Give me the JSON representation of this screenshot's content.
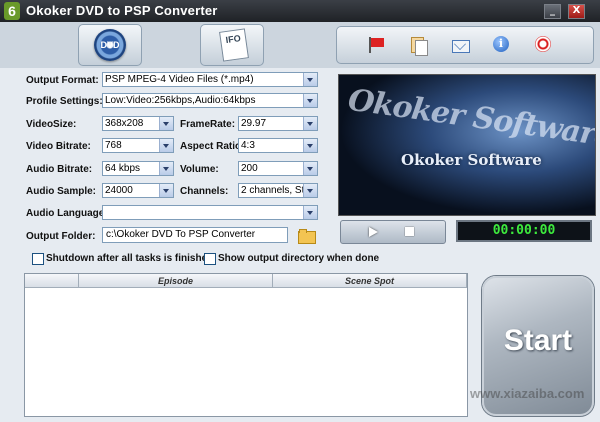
{
  "window": {
    "title": "Okoker DVD to PSP Converter",
    "icon_glyph": "6",
    "minimize": "_",
    "close": "X"
  },
  "source_tabs": {
    "dvd_label": "DVD",
    "ifo_label": "IFO"
  },
  "settings": {
    "output_format": {
      "label": "Output Format:",
      "value": "PSP MPEG-4 Video Files (*.mp4)"
    },
    "profile": {
      "label": "Profile Settings:",
      "value": "Low:Video:256kbps,Audio:64kbps"
    },
    "video_size": {
      "label": "VideoSize:",
      "value": "368x208"
    },
    "frame_rate": {
      "label": "FrameRate:",
      "value": "29.97"
    },
    "video_bitrate": {
      "label": "Video Bitrate:",
      "value": "768"
    },
    "aspect_ratio": {
      "label": "Aspect Ratio:",
      "value": "4:3"
    },
    "audio_bitrate": {
      "label": "Audio Bitrate:",
      "value": "64 kbps"
    },
    "volume": {
      "label": "Volume:",
      "value": "200"
    },
    "audio_sample": {
      "label": "Audio Sample:",
      "value": "24000"
    },
    "channels": {
      "label": "Channels:",
      "value": "2 channels, St"
    },
    "audio_language": {
      "label": "Audio Language:",
      "value": ""
    },
    "output_folder": {
      "label": "Output Folder:",
      "value": "c:\\Okoker DVD To PSP Converter"
    }
  },
  "preview": {
    "logo_art": "Okoker Software",
    "logo_text": "Okoker Software"
  },
  "player": {
    "timer": "00:00:00"
  },
  "options": {
    "shutdown": "Shutdown after all tasks is finished",
    "show_dir": "Show output directory when done"
  },
  "tasklist": {
    "col_episode": "Episode",
    "col_scene": "Scene Spot"
  },
  "start": {
    "label": "Start"
  },
  "watermark": "www.xiazaiba.com"
}
